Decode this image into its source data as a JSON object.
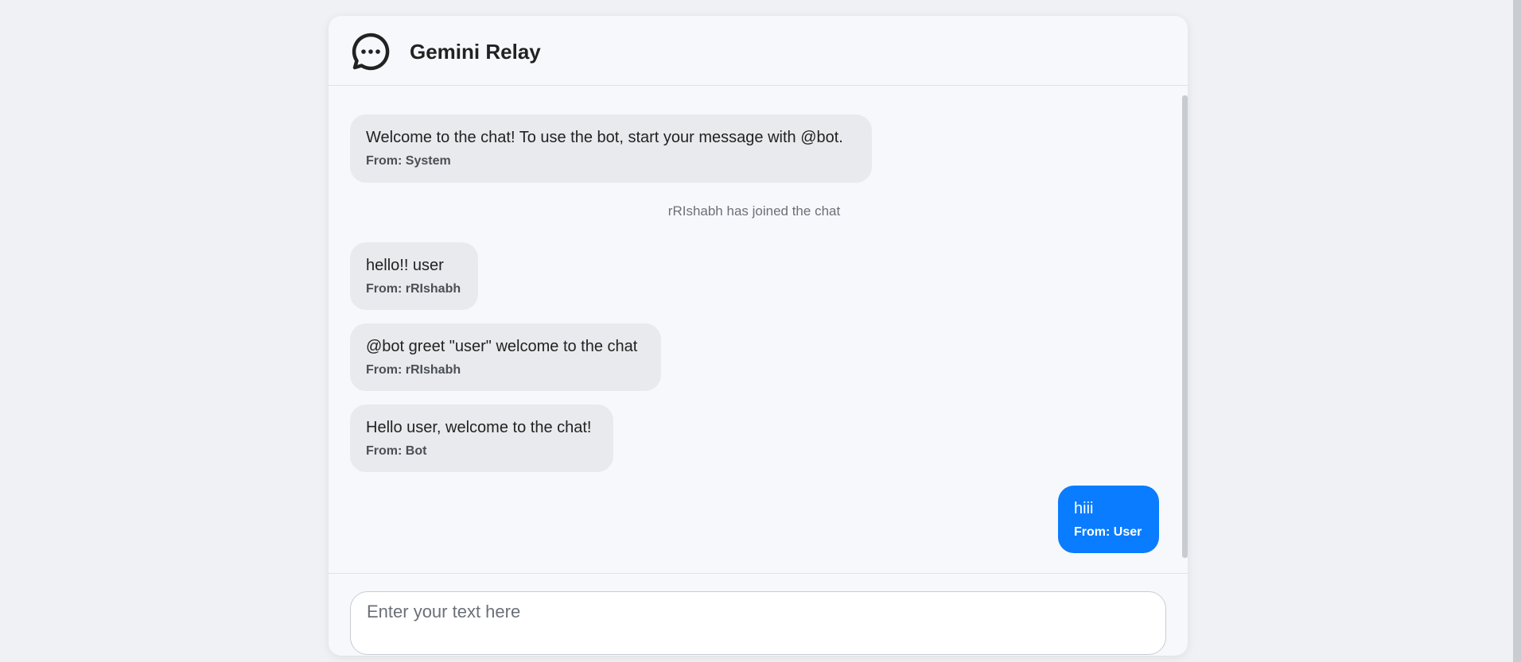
{
  "app": {
    "title": "Gemini Relay",
    "logo_icon": "chat-bubble-icon"
  },
  "messages": [
    {
      "text": "Welcome to the chat! To use the bot, start your message with @bot.",
      "from": "From: System"
    },
    {
      "text": "hello!! user",
      "from": "From: rRIshabh"
    },
    {
      "text": "@bot greet \"user\" welcome to the chat",
      "from": "From: rRIshabh"
    },
    {
      "text": "Hello user, welcome to the chat!",
      "from": "From: Bot"
    },
    {
      "text": "hiii",
      "from": "From: User"
    }
  ],
  "system_notice": "rRIshabh has joined the chat",
  "composer": {
    "placeholder": "Enter your text here",
    "value": ""
  },
  "colors": {
    "own_message": "#0a7cff",
    "other_message": "#e8eaed"
  }
}
